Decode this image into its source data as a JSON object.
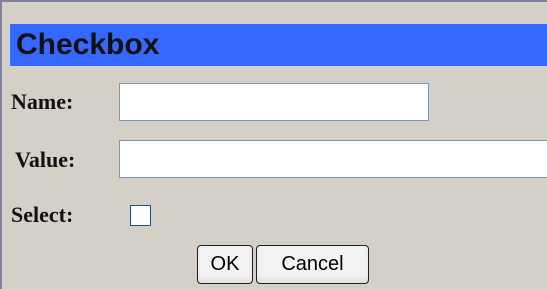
{
  "dialog": {
    "title": "Checkbox"
  },
  "fields": {
    "name_label": "Name:",
    "name_value": "",
    "value_label": "Value:",
    "value_value": "",
    "select_label": "Select:",
    "select_checked": false
  },
  "buttons": {
    "ok": "OK",
    "cancel": "Cancel"
  }
}
